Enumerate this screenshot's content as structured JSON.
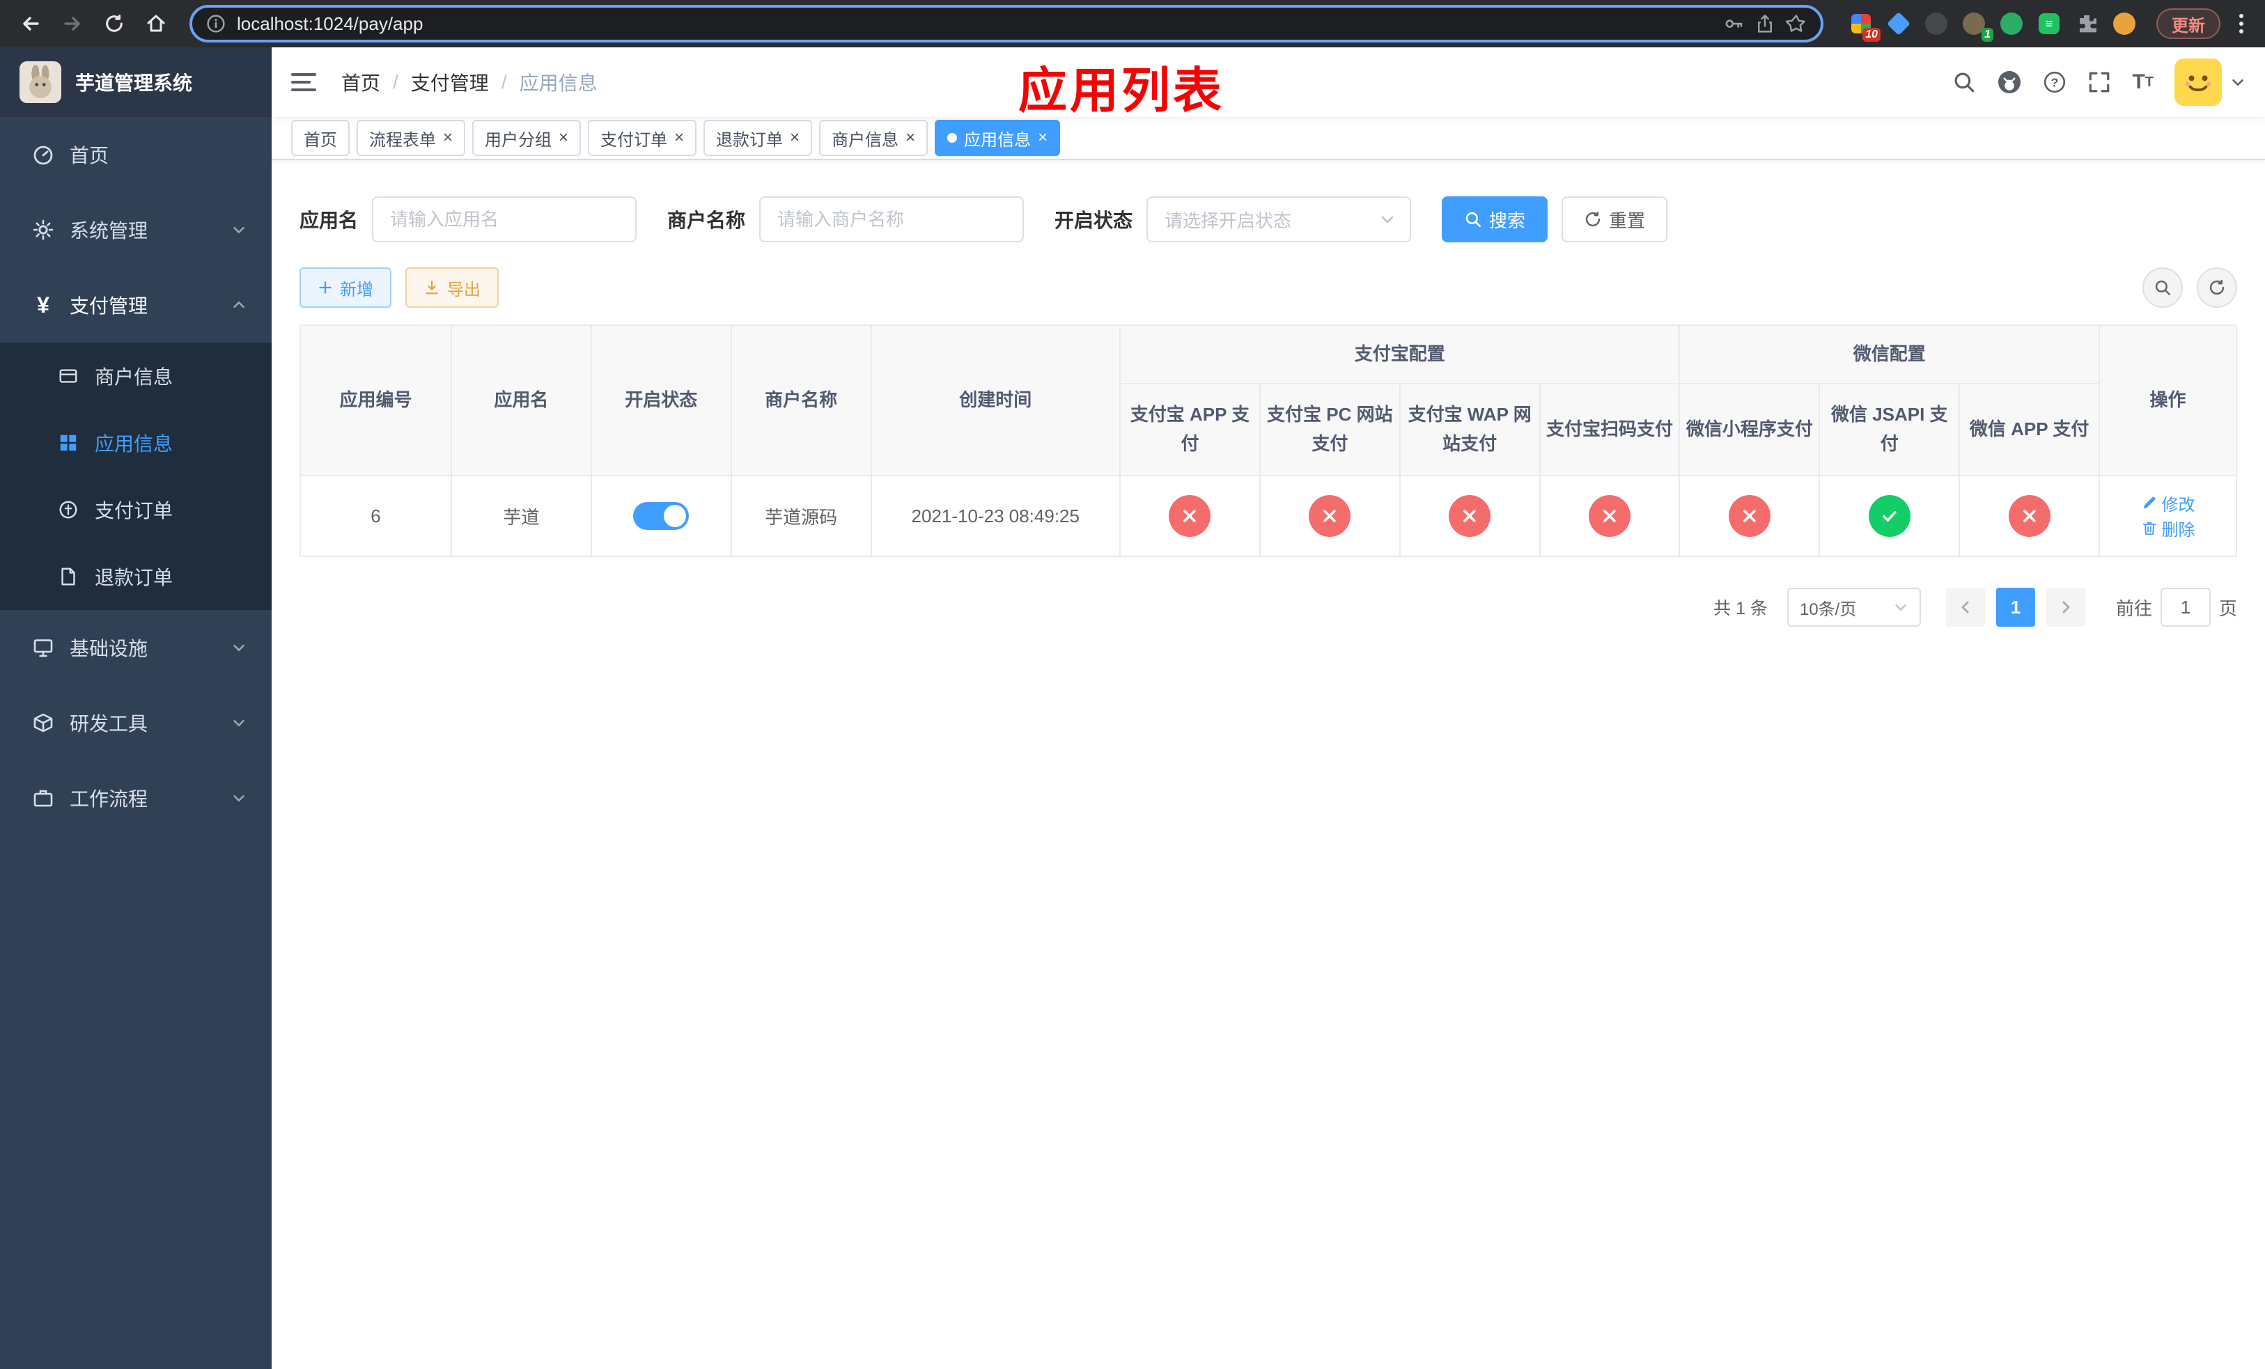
{
  "colors": {
    "primary": "#409EFF",
    "success": "#13ce66",
    "danger": "#f56c6c",
    "warning": "#e6a23c",
    "annotation_red": "#f50202",
    "sidebar_bg": "#304156",
    "submenu_bg": "#1f2d3d"
  },
  "browser": {
    "url": "localhost:1024/pay/app",
    "update_label": "更新",
    "extensions_badge": "10",
    "profile_badge": "1"
  },
  "sidebar": {
    "title": "芋道管理系统",
    "menu": {
      "home": "首页",
      "system": "系统管理",
      "payment": "支付管理",
      "infra": "基础设施",
      "devtools": "研发工具",
      "workflow": "工作流程"
    },
    "payment_submenu": {
      "merchant": "商户信息",
      "app": "应用信息",
      "order": "支付订单",
      "refund": "退款订单"
    }
  },
  "navbar": {
    "breadcrumb": {
      "home": "首页",
      "section": "支付管理",
      "current": "应用信息"
    },
    "annotation": "应用列表"
  },
  "tabs": [
    {
      "label": "首页",
      "closable": false,
      "active": false
    },
    {
      "label": "流程表单",
      "closable": true,
      "active": false
    },
    {
      "label": "用户分组",
      "closable": true,
      "active": false
    },
    {
      "label": "支付订单",
      "closable": true,
      "active": false
    },
    {
      "label": "退款订单",
      "closable": true,
      "active": false
    },
    {
      "label": "商户信息",
      "closable": true,
      "active": false
    },
    {
      "label": "应用信息",
      "closable": true,
      "active": true
    }
  ],
  "filters": {
    "app_name": {
      "label": "应用名",
      "placeholder": "请输入应用名"
    },
    "merchant_name": {
      "label": "商户名称",
      "placeholder": "请输入商户名称"
    },
    "status": {
      "label": "开启状态",
      "placeholder": "请选择开启状态"
    },
    "search": "搜索",
    "reset": "重置"
  },
  "toolbar": {
    "add": "新增",
    "export": "导出"
  },
  "table": {
    "groups": {
      "alipay": "支付宝配置",
      "wechat": "微信配置"
    },
    "columns": {
      "id": "应用编号",
      "name": "应用名",
      "status": "开启状态",
      "merchant": "商户名称",
      "created": "创建时间",
      "alipay_app": "支付宝 APP 支付",
      "alipay_pc": "支付宝 PC 网站支付",
      "alipay_wap": "支付宝 WAP 网站支付",
      "alipay_scan": "支付宝扫码支付",
      "wechat_mini": "微信小程序支付",
      "wechat_jsapi": "微信 JSAPI 支付",
      "wechat_app": "微信 APP 支付",
      "actions": "操作"
    },
    "rows": [
      {
        "id": "6",
        "name": "芋道",
        "status_on": true,
        "merchant": "芋道源码",
        "created": "2021-10-23 08:49:25",
        "channels": {
          "alipay_app": false,
          "alipay_pc": false,
          "alipay_wap": false,
          "alipay_scan": false,
          "wechat_mini": false,
          "wechat_jsapi": true,
          "wechat_app": false
        },
        "edit": "修改",
        "delete": "删除"
      }
    ]
  },
  "pagination": {
    "total": "共 1 条",
    "page_size": "10条/页",
    "page": "1",
    "goto": "前往",
    "goto_value": "1",
    "unit": "页"
  }
}
